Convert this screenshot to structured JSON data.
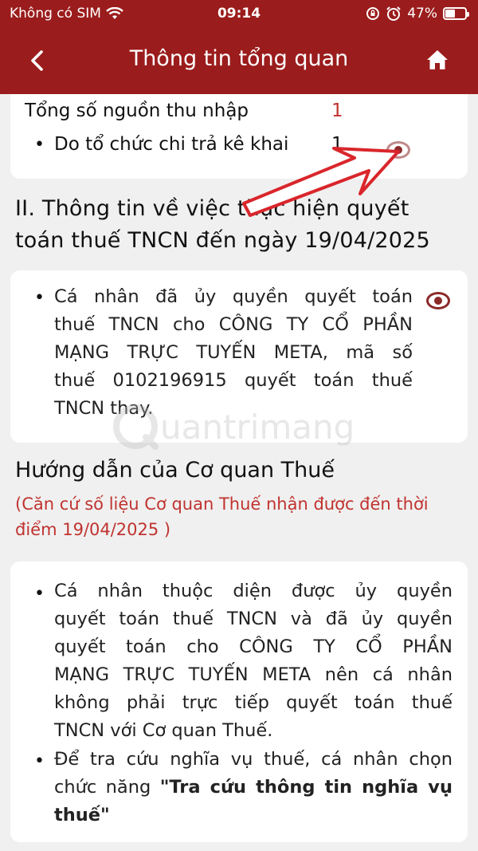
{
  "status_bar": {
    "carrier": "Không có SIM",
    "time": "09:14",
    "battery": "47%"
  },
  "nav": {
    "title": "Thông tin tổng quan"
  },
  "income": {
    "total_label": "Tổng số nguồn thu nhập",
    "total_value": "1",
    "org_label": "Do tổ chức chi trả kê khai",
    "org_value": "1"
  },
  "section2": {
    "title_line1": "II. Thông tin về việc thực hiện quyết",
    "title_line2": "toán thuế TNCN đến ngày 19/04/2025",
    "lines": [
      "Cá nhân đã ủy quyền quyết toán",
      "thuế TNCN cho CÔNG TY CỔ PHẦN",
      "MẠNG TRỰC TUYẾN META, mã số",
      "thuế 0102196915 quyết toán thuế",
      "TNCN thay."
    ]
  },
  "guidance": {
    "title": "Hướng dẫn của Cơ quan Thuế",
    "note_line1": "(Căn cứ số liệu Cơ quan Thuế nhận được đến thời",
    "note_line2": "điểm 19/04/2025 )",
    "item1_lines": [
      "Cá nhân thuộc diện được ủy quyền",
      "quyết toán thuế TNCN và đã ủy quyền",
      "quyết toán cho CÔNG TY CỔ PHẦN",
      "MẠNG TRỰC TUYẾN META nên cá nhân",
      "không phải trực tiếp quyết toán thuế",
      "TNCN với Cơ quan Thuế."
    ],
    "item2_line1": "Để tra cứu nghĩa vụ thuế, cá nhân chọn",
    "item2_line2_prefix": "chức năng ",
    "item2_line2_bold": "\"Tra cứu thông tin nghĩa vụ",
    "item2_line3_bold": "thuế\""
  },
  "watermark": "uantrimang",
  "colors": {
    "header": "#9b1c1c",
    "accent": "#c0332f",
    "eye": "#8b2a2a"
  },
  "icons": [
    "back-chevron-icon",
    "home-icon",
    "wifi-icon",
    "alarm-icon",
    "battery-icon",
    "eye-icon"
  ]
}
